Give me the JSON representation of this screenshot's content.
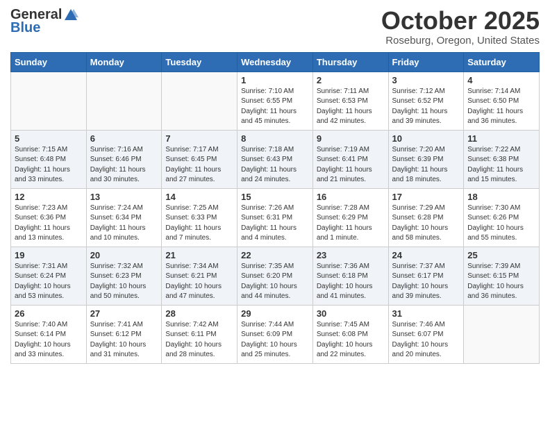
{
  "logo": {
    "general": "General",
    "blue": "Blue"
  },
  "header": {
    "month": "October 2025",
    "location": "Roseburg, Oregon, United States"
  },
  "weekdays": [
    "Sunday",
    "Monday",
    "Tuesday",
    "Wednesday",
    "Thursday",
    "Friday",
    "Saturday"
  ],
  "weeks": [
    [
      {
        "day": "",
        "sunrise": "",
        "sunset": "",
        "daylight": ""
      },
      {
        "day": "",
        "sunrise": "",
        "sunset": "",
        "daylight": ""
      },
      {
        "day": "",
        "sunrise": "",
        "sunset": "",
        "daylight": ""
      },
      {
        "day": "1",
        "sunrise": "Sunrise: 7:10 AM",
        "sunset": "Sunset: 6:55 PM",
        "daylight": "Daylight: 11 hours and 45 minutes."
      },
      {
        "day": "2",
        "sunrise": "Sunrise: 7:11 AM",
        "sunset": "Sunset: 6:53 PM",
        "daylight": "Daylight: 11 hours and 42 minutes."
      },
      {
        "day": "3",
        "sunrise": "Sunrise: 7:12 AM",
        "sunset": "Sunset: 6:52 PM",
        "daylight": "Daylight: 11 hours and 39 minutes."
      },
      {
        "day": "4",
        "sunrise": "Sunrise: 7:14 AM",
        "sunset": "Sunset: 6:50 PM",
        "daylight": "Daylight: 11 hours and 36 minutes."
      }
    ],
    [
      {
        "day": "5",
        "sunrise": "Sunrise: 7:15 AM",
        "sunset": "Sunset: 6:48 PM",
        "daylight": "Daylight: 11 hours and 33 minutes."
      },
      {
        "day": "6",
        "sunrise": "Sunrise: 7:16 AM",
        "sunset": "Sunset: 6:46 PM",
        "daylight": "Daylight: 11 hours and 30 minutes."
      },
      {
        "day": "7",
        "sunrise": "Sunrise: 7:17 AM",
        "sunset": "Sunset: 6:45 PM",
        "daylight": "Daylight: 11 hours and 27 minutes."
      },
      {
        "day": "8",
        "sunrise": "Sunrise: 7:18 AM",
        "sunset": "Sunset: 6:43 PM",
        "daylight": "Daylight: 11 hours and 24 minutes."
      },
      {
        "day": "9",
        "sunrise": "Sunrise: 7:19 AM",
        "sunset": "Sunset: 6:41 PM",
        "daylight": "Daylight: 11 hours and 21 minutes."
      },
      {
        "day": "10",
        "sunrise": "Sunrise: 7:20 AM",
        "sunset": "Sunset: 6:39 PM",
        "daylight": "Daylight: 11 hours and 18 minutes."
      },
      {
        "day": "11",
        "sunrise": "Sunrise: 7:22 AM",
        "sunset": "Sunset: 6:38 PM",
        "daylight": "Daylight: 11 hours and 15 minutes."
      }
    ],
    [
      {
        "day": "12",
        "sunrise": "Sunrise: 7:23 AM",
        "sunset": "Sunset: 6:36 PM",
        "daylight": "Daylight: 11 hours and 13 minutes."
      },
      {
        "day": "13",
        "sunrise": "Sunrise: 7:24 AM",
        "sunset": "Sunset: 6:34 PM",
        "daylight": "Daylight: 11 hours and 10 minutes."
      },
      {
        "day": "14",
        "sunrise": "Sunrise: 7:25 AM",
        "sunset": "Sunset: 6:33 PM",
        "daylight": "Daylight: 11 hours and 7 minutes."
      },
      {
        "day": "15",
        "sunrise": "Sunrise: 7:26 AM",
        "sunset": "Sunset: 6:31 PM",
        "daylight": "Daylight: 11 hours and 4 minutes."
      },
      {
        "day": "16",
        "sunrise": "Sunrise: 7:28 AM",
        "sunset": "Sunset: 6:29 PM",
        "daylight": "Daylight: 11 hours and 1 minute."
      },
      {
        "day": "17",
        "sunrise": "Sunrise: 7:29 AM",
        "sunset": "Sunset: 6:28 PM",
        "daylight": "Daylight: 10 hours and 58 minutes."
      },
      {
        "day": "18",
        "sunrise": "Sunrise: 7:30 AM",
        "sunset": "Sunset: 6:26 PM",
        "daylight": "Daylight: 10 hours and 55 minutes."
      }
    ],
    [
      {
        "day": "19",
        "sunrise": "Sunrise: 7:31 AM",
        "sunset": "Sunset: 6:24 PM",
        "daylight": "Daylight: 10 hours and 53 minutes."
      },
      {
        "day": "20",
        "sunrise": "Sunrise: 7:32 AM",
        "sunset": "Sunset: 6:23 PM",
        "daylight": "Daylight: 10 hours and 50 minutes."
      },
      {
        "day": "21",
        "sunrise": "Sunrise: 7:34 AM",
        "sunset": "Sunset: 6:21 PM",
        "daylight": "Daylight: 10 hours and 47 minutes."
      },
      {
        "day": "22",
        "sunrise": "Sunrise: 7:35 AM",
        "sunset": "Sunset: 6:20 PM",
        "daylight": "Daylight: 10 hours and 44 minutes."
      },
      {
        "day": "23",
        "sunrise": "Sunrise: 7:36 AM",
        "sunset": "Sunset: 6:18 PM",
        "daylight": "Daylight: 10 hours and 41 minutes."
      },
      {
        "day": "24",
        "sunrise": "Sunrise: 7:37 AM",
        "sunset": "Sunset: 6:17 PM",
        "daylight": "Daylight: 10 hours and 39 minutes."
      },
      {
        "day": "25",
        "sunrise": "Sunrise: 7:39 AM",
        "sunset": "Sunset: 6:15 PM",
        "daylight": "Daylight: 10 hours and 36 minutes."
      }
    ],
    [
      {
        "day": "26",
        "sunrise": "Sunrise: 7:40 AM",
        "sunset": "Sunset: 6:14 PM",
        "daylight": "Daylight: 10 hours and 33 minutes."
      },
      {
        "day": "27",
        "sunrise": "Sunrise: 7:41 AM",
        "sunset": "Sunset: 6:12 PM",
        "daylight": "Daylight: 10 hours and 31 minutes."
      },
      {
        "day": "28",
        "sunrise": "Sunrise: 7:42 AM",
        "sunset": "Sunset: 6:11 PM",
        "daylight": "Daylight: 10 hours and 28 minutes."
      },
      {
        "day": "29",
        "sunrise": "Sunrise: 7:44 AM",
        "sunset": "Sunset: 6:09 PM",
        "daylight": "Daylight: 10 hours and 25 minutes."
      },
      {
        "day": "30",
        "sunrise": "Sunrise: 7:45 AM",
        "sunset": "Sunset: 6:08 PM",
        "daylight": "Daylight: 10 hours and 22 minutes."
      },
      {
        "day": "31",
        "sunrise": "Sunrise: 7:46 AM",
        "sunset": "Sunset: 6:07 PM",
        "daylight": "Daylight: 10 hours and 20 minutes."
      },
      {
        "day": "",
        "sunrise": "",
        "sunset": "",
        "daylight": ""
      }
    ]
  ]
}
